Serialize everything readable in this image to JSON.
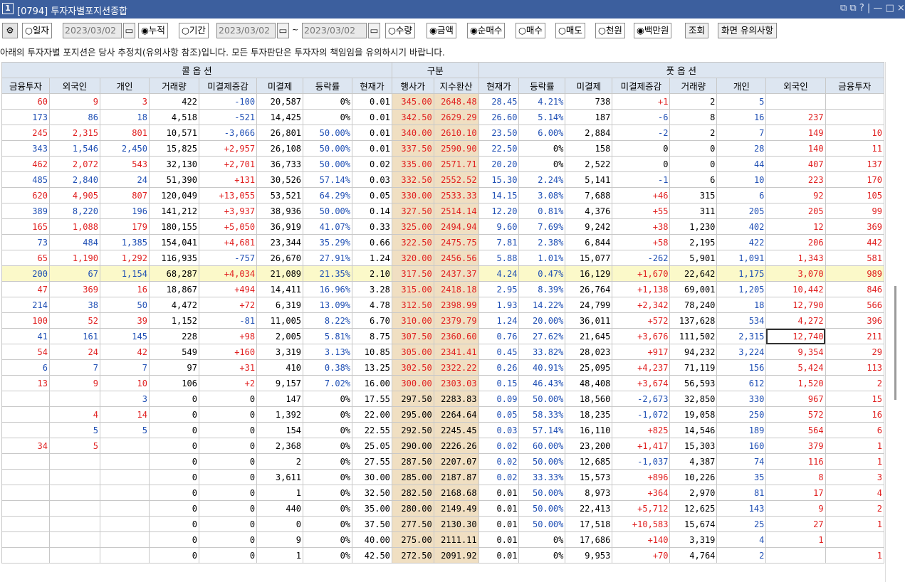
{
  "window": {
    "number": "1",
    "title": "[0794] 투자자별포지션종합",
    "controls": "⧉ ⧉ ? | — □ ×"
  },
  "toolbar": {
    "mode_day": "○일자",
    "date_single": "2023/03/02",
    "mode_cum": "◉누적",
    "mode_period": "○기간",
    "date_from": "2023/03/02",
    "tilde": "~",
    "date_to": "2023/03/02",
    "qty": "○수량",
    "amt": "◉금액",
    "net": "◉순매수",
    "buy": "○매수",
    "sell": "○매도",
    "won": "○천원",
    "mil": "◉백만원",
    "query_btn": "조회",
    "notice_btn": "화면 유의사항"
  },
  "notice": "아래의 투자자별 포지션은 당사 추정치(유의사항 참조)입니다. 모든 투자판단은 투자자의 책임임을 유의하시기 바랍니다.",
  "grid": {
    "group_call": "콜 옵 션",
    "group_mid": "구분",
    "group_put": "풋 옵 션",
    "headers": [
      "금융투자",
      "외국인",
      "개인",
      "거래량",
      "미결제증감",
      "미결제",
      "등락률",
      "현재가",
      "행사가",
      "지수환산",
      "현재가",
      "등락률",
      "미결제",
      "미결제증감",
      "거래량",
      "개인",
      "외국인",
      "금융투자"
    ],
    "rows": [
      [
        "60",
        "9",
        "3",
        "422",
        "-100",
        "20,587",
        "0%",
        "0.01",
        "345.00",
        "2648.48",
        "28.45",
        "4.21%",
        "738",
        "+1",
        "2",
        "5",
        "",
        ""
      ],
      [
        "173",
        "86",
        "18",
        "4,518",
        "-521",
        "14,425",
        "0%",
        "0.01",
        "342.50",
        "2629.29",
        "26.60",
        "5.14%",
        "187",
        "-6",
        "8",
        "16",
        "237",
        ""
      ],
      [
        "245",
        "2,315",
        "801",
        "10,571",
        "-3,066",
        "26,801",
        "50.00%",
        "0.01",
        "340.00",
        "2610.10",
        "23.50",
        "6.00%",
        "2,884",
        "-2",
        "2",
        "7",
        "149",
        "10"
      ],
      [
        "343",
        "1,546",
        "2,450",
        "15,825",
        "+2,957",
        "26,108",
        "50.00%",
        "0.01",
        "337.50",
        "2590.90",
        "22.50",
        "0%",
        "158",
        "0",
        "0",
        "28",
        "140",
        "11"
      ],
      [
        "462",
        "2,072",
        "543",
        "32,130",
        "+2,701",
        "36,733",
        "50.00%",
        "0.02",
        "335.00",
        "2571.71",
        "20.20",
        "0%",
        "2,522",
        "0",
        "0",
        "44",
        "407",
        "137"
      ],
      [
        "485",
        "2,840",
        "24",
        "51,390",
        "+131",
        "30,526",
        "57.14%",
        "0.03",
        "332.50",
        "2552.52",
        "15.30",
        "2.24%",
        "5,141",
        "-1",
        "6",
        "10",
        "223",
        "170"
      ],
      [
        "620",
        "4,905",
        "807",
        "120,049",
        "+13,055",
        "53,521",
        "64.29%",
        "0.05",
        "330.00",
        "2533.33",
        "14.15",
        "3.08%",
        "7,688",
        "+46",
        "315",
        "6",
        "92",
        "105"
      ],
      [
        "389",
        "8,220",
        "196",
        "141,212",
        "+3,937",
        "38,936",
        "50.00%",
        "0.14",
        "327.50",
        "2514.14",
        "12.20",
        "0.81%",
        "4,376",
        "+55",
        "311",
        "205",
        "205",
        "99"
      ],
      [
        "165",
        "1,088",
        "179",
        "180,155",
        "+5,050",
        "36,919",
        "41.07%",
        "0.33",
        "325.00",
        "2494.94",
        "9.60",
        "7.69%",
        "9,242",
        "+38",
        "1,230",
        "402",
        "12",
        "369"
      ],
      [
        "73",
        "484",
        "1,385",
        "154,041",
        "+4,681",
        "23,344",
        "35.29%",
        "0.66",
        "322.50",
        "2475.75",
        "7.81",
        "2.38%",
        "6,844",
        "+58",
        "2,195",
        "422",
        "206",
        "442"
      ],
      [
        "65",
        "1,190",
        "1,292",
        "116,935",
        "-757",
        "26,670",
        "27.91%",
        "1.24",
        "320.00",
        "2456.56",
        "5.88",
        "1.01%",
        "15,077",
        "-262",
        "5,901",
        "1,091",
        "1,343",
        "581"
      ],
      [
        "200",
        "67",
        "1,154",
        "68,287",
        "+4,034",
        "21,089",
        "21.35%",
        "2.10",
        "317.50",
        "2437.37",
        "4.24",
        "0.47%",
        "16,129",
        "+1,670",
        "22,642",
        "1,175",
        "3,070",
        "989"
      ],
      [
        "47",
        "369",
        "16",
        "18,867",
        "+494",
        "14,411",
        "16.96%",
        "3.28",
        "315.00",
        "2418.18",
        "2.95",
        "8.39%",
        "26,764",
        "+1,138",
        "69,001",
        "1,205",
        "10,442",
        "846"
      ],
      [
        "214",
        "38",
        "50",
        "4,472",
        "+72",
        "6,319",
        "13.09%",
        "4.78",
        "312.50",
        "2398.99",
        "1.93",
        "14.22%",
        "24,799",
        "+2,342",
        "78,240",
        "18",
        "12,790",
        "566"
      ],
      [
        "100",
        "52",
        "39",
        "1,152",
        "-81",
        "11,005",
        "8.22%",
        "6.70",
        "310.00",
        "2379.79",
        "1.24",
        "20.00%",
        "36,011",
        "+572",
        "137,628",
        "534",
        "4,272",
        "396"
      ],
      [
        "41",
        "161",
        "145",
        "228",
        "+98",
        "2,005",
        "5.81%",
        "8.75",
        "307.50",
        "2360.60",
        "0.76",
        "27.62%",
        "21,645",
        "+3,676",
        "111,502",
        "2,315",
        "12,740",
        "211"
      ],
      [
        "54",
        "24",
        "42",
        "549",
        "+160",
        "3,319",
        "3.13%",
        "10.85",
        "305.00",
        "2341.41",
        "0.45",
        "33.82%",
        "28,023",
        "+917",
        "94,232",
        "3,224",
        "9,354",
        "29"
      ],
      [
        "6",
        "7",
        "7",
        "97",
        "+31",
        "410",
        "0.38%",
        "13.25",
        "302.50",
        "2322.22",
        "0.26",
        "40.91%",
        "25,095",
        "+4,237",
        "71,119",
        "156",
        "5,424",
        "113"
      ],
      [
        "13",
        "9",
        "10",
        "106",
        "+2",
        "9,157",
        "7.02%",
        "16.00",
        "300.00",
        "2303.03",
        "0.15",
        "46.43%",
        "48,408",
        "+3,674",
        "56,593",
        "612",
        "1,520",
        "2"
      ],
      [
        "",
        "",
        "3",
        "0",
        "0",
        "147",
        "0%",
        "17.55",
        "297.50",
        "2283.83",
        "0.09",
        "50.00%",
        "18,560",
        "-2,673",
        "32,850",
        "330",
        "967",
        "15"
      ],
      [
        "",
        "4",
        "14",
        "0",
        "0",
        "1,392",
        "0%",
        "22.00",
        "295.00",
        "2264.64",
        "0.05",
        "58.33%",
        "18,235",
        "-1,072",
        "19,058",
        "250",
        "572",
        "16"
      ],
      [
        "",
        "5",
        "5",
        "0",
        "0",
        "154",
        "0%",
        "22.55",
        "292.50",
        "2245.45",
        "0.03",
        "57.14%",
        "16,110",
        "+825",
        "14,546",
        "189",
        "564",
        "6"
      ],
      [
        "34",
        "5",
        "",
        "0",
        "0",
        "2,368",
        "0%",
        "25.05",
        "290.00",
        "2226.26",
        "0.02",
        "60.00%",
        "23,200",
        "+1,417",
        "15,303",
        "160",
        "379",
        "1"
      ],
      [
        "",
        "",
        "",
        "0",
        "0",
        "2",
        "0%",
        "27.55",
        "287.50",
        "2207.07",
        "0.02",
        "50.00%",
        "12,685",
        "-1,037",
        "4,387",
        "74",
        "116",
        "1"
      ],
      [
        "",
        "",
        "",
        "0",
        "0",
        "3,611",
        "0%",
        "30.00",
        "285.00",
        "2187.87",
        "0.02",
        "33.33%",
        "15,573",
        "+896",
        "10,226",
        "35",
        "8",
        "3"
      ],
      [
        "",
        "",
        "",
        "0",
        "0",
        "1",
        "0%",
        "32.50",
        "282.50",
        "2168.68",
        "0.01",
        "50.00%",
        "8,973",
        "+364",
        "2,970",
        "81",
        "17",
        "4"
      ],
      [
        "",
        "",
        "",
        "0",
        "0",
        "440",
        "0%",
        "35.00",
        "280.00",
        "2149.49",
        "0.01",
        "50.00%",
        "22,413",
        "+5,712",
        "12,625",
        "143",
        "9",
        "2"
      ],
      [
        "",
        "",
        "",
        "0",
        "0",
        "0",
        "0%",
        "37.50",
        "277.50",
        "2130.30",
        "0.01",
        "50.00%",
        "17,518",
        "+10,583",
        "15,674",
        "25",
        "27",
        "1"
      ],
      [
        "",
        "",
        "",
        "0",
        "0",
        "9",
        "0%",
        "40.00",
        "275.00",
        "2111.11",
        "0.01",
        "0%",
        "17,686",
        "+140",
        "3,319",
        "4",
        "1",
        ""
      ],
      [
        "",
        "",
        "",
        "0",
        "0",
        "1",
        "0%",
        "42.50",
        "272.50",
        "2091.92",
        "0.01",
        "0%",
        "9,953",
        "+70",
        "4,764",
        "2",
        "",
        "1"
      ]
    ],
    "colors": {
      "pos": "#e02020",
      "neg": "#1f4fb4",
      "strike_bg": "#f0dfc2",
      "highlight_bg": "#fbf9c9",
      "header_bg": "#dde6f1"
    }
  }
}
